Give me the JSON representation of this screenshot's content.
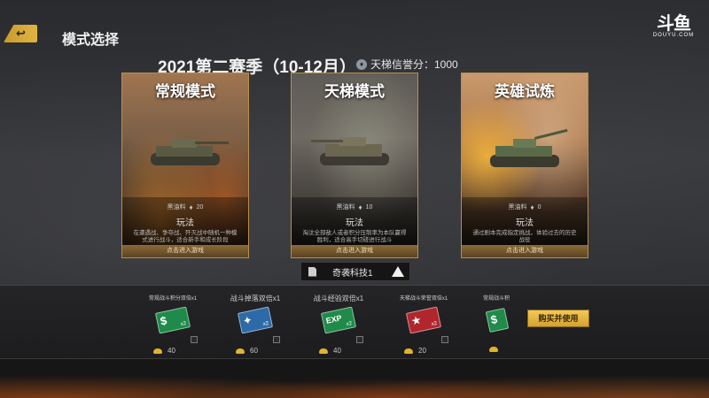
{
  "header": {
    "back_label": "↩",
    "title": "模式选择"
  },
  "logo": {
    "mark": "斗鱼",
    "sub": "DOUYU.COM"
  },
  "season": {
    "title": "2021第二赛季（10-12月）",
    "credit_label": "天梯信誉分：1000"
  },
  "cards": [
    {
      "title": "常规模式",
      "cost_label": "黑油料",
      "cost_value": "20",
      "play_label": "玩法",
      "desc": "在遭遇战、争夺战、歼灭战中随机一种模式进行战斗，适合新手和成长阶段",
      "enter": "点击进入游戏"
    },
    {
      "title": "天梯模式",
      "cost_label": "黑油料",
      "cost_value": "10",
      "play_label": "玩法",
      "desc": "淘汰全部敌人或者积分压制率为本队赢得胜利，适合高手切磋进行战斗",
      "enter": "点击进入游戏"
    },
    {
      "title": "英雄试炼",
      "cost_label": "黑油料",
      "cost_value": "0",
      "play_label": "玩法",
      "desc": "通过剧本完成指定挑战，体验过去的历史战役",
      "enter": "点击进入游戏"
    }
  ],
  "dropdown": {
    "value": "奇袭科技1"
  },
  "items": [
    {
      "label": "常规战斗积分双倍x1",
      "badge": "$",
      "mult": "x2",
      "price": "40",
      "color": "#1f8a4a"
    },
    {
      "label": "战斗掉落双倍x1",
      "badge": "✦",
      "mult": "x2",
      "price": "60",
      "color": "#2d6aa8"
    },
    {
      "label": "战斗经验双倍x1",
      "badge": "EXP",
      "mult": "x2",
      "price": "40",
      "color": "#1f8a4a"
    },
    {
      "label": "天梯战斗荣誉双倍x1",
      "badge": "★",
      "mult": "x2",
      "price": "20",
      "color": "#b0262c"
    },
    {
      "label": "常规战斗积",
      "badge": "$",
      "mult": "",
      "price": "",
      "color": "#1f8a4a"
    }
  ],
  "buy_button": "购买并使用"
}
